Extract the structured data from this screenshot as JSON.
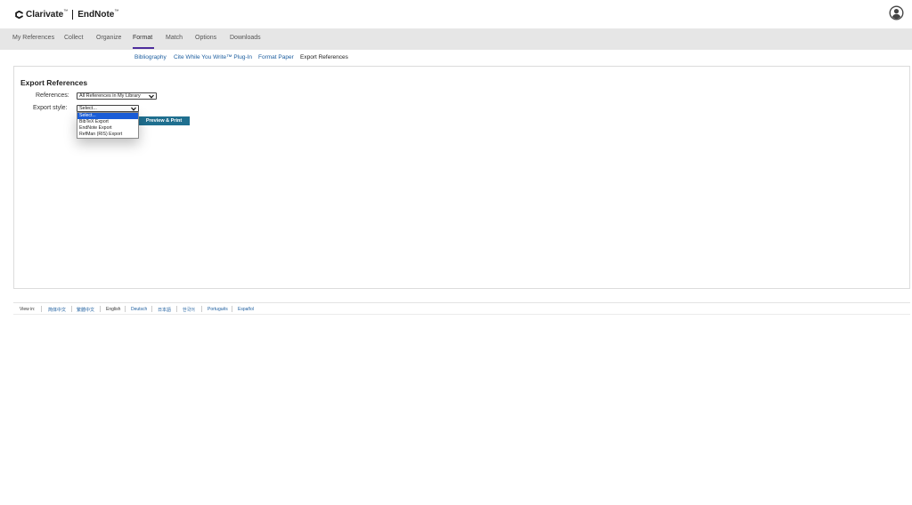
{
  "header": {
    "brand_left": "Clarivate",
    "brand_right": "EndNote",
    "trademark": "™"
  },
  "nav": {
    "items": [
      {
        "label": "My References"
      },
      {
        "label": "Collect"
      },
      {
        "label": "Organize"
      },
      {
        "label": "Format"
      },
      {
        "label": "Match"
      },
      {
        "label": "Options"
      },
      {
        "label": "Downloads"
      }
    ],
    "active": "Format"
  },
  "subnav": {
    "items": [
      {
        "label": "Bibliography"
      },
      {
        "label": "Cite While You Write™ Plug-In"
      },
      {
        "label": "Format Paper"
      },
      {
        "label": "Export References"
      }
    ],
    "current": "Export References"
  },
  "export": {
    "title": "Export References",
    "references_label": "References:",
    "references_value": "All References in My Library",
    "style_label": "Export style:",
    "style_value": "Select...",
    "preview_button": "Preview & Print",
    "style_options": [
      {
        "label": "Select..."
      },
      {
        "label": "BibTeX Export"
      },
      {
        "label": "EndNote Export"
      },
      {
        "label": "RefMan (RIS) Export"
      }
    ],
    "highlighted_option": "Select..."
  },
  "footer": {
    "view_in": "View in:",
    "languages": [
      {
        "label": "简体中文"
      },
      {
        "label": "繁體中文"
      },
      {
        "label": "English"
      },
      {
        "label": "Deutsch"
      },
      {
        "label": "日本語"
      },
      {
        "label": "한국어"
      },
      {
        "label": "Português"
      },
      {
        "label": "Español"
      }
    ],
    "current_language": "English"
  },
  "colors": {
    "nav_bg": "#e6e6e6",
    "nav_active_underline": "#4d2d9c",
    "link": "#1a5c9e",
    "button_bg": "#1f6f8f",
    "selected_option_bg": "#1a5cd6"
  }
}
